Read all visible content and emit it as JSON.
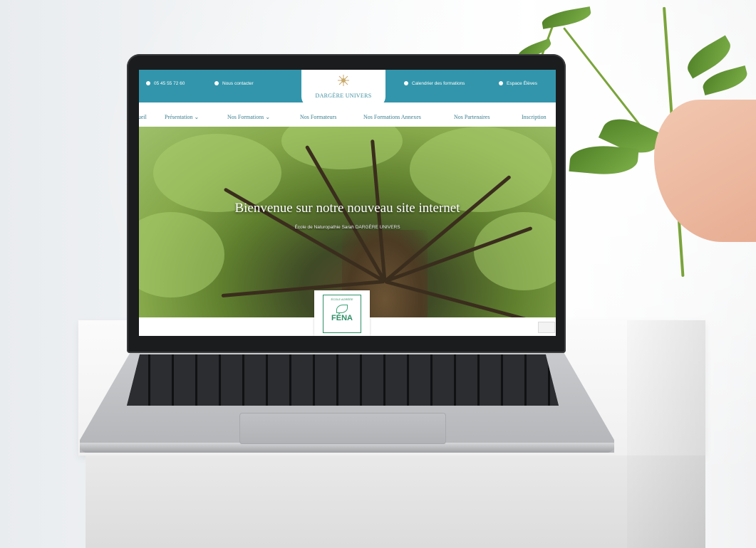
{
  "site": {
    "topbar": {
      "phone": "05 45 55 72 60",
      "contact": "Nous contacter",
      "calendar": "Calendrier des formations",
      "space": "Espace Élèves"
    },
    "logo_text": "DARGÈRE UNIVERS",
    "nav": {
      "items": [
        {
          "label": "Accueil"
        },
        {
          "label": "Présentation ⌄"
        },
        {
          "label": "Nos Formations ⌄"
        },
        {
          "label": "Nos Formateurs"
        },
        {
          "label": "Nos Formations Annexes"
        },
        {
          "label": "Nos Partenaires"
        },
        {
          "label": "Inscription"
        }
      ]
    },
    "hero": {
      "title": "Bienvenue sur notre nouveau site internet",
      "subtitle": "École de Naturopathie Sarah DARGÈRE UNIVERS"
    },
    "badge": {
      "top": "ÉCOLE AGRÉÉE",
      "name": "FÉNA"
    }
  },
  "colors": {
    "accent": "#3295ab",
    "badge_green": "#2e8e67"
  }
}
